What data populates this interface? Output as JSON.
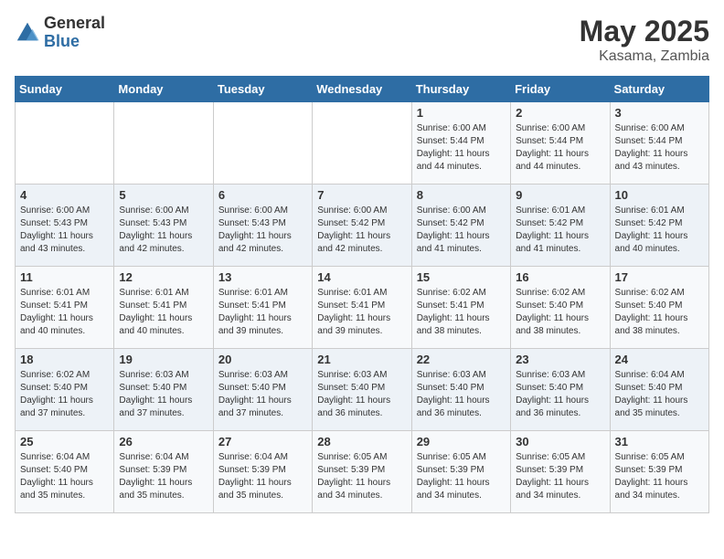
{
  "logo": {
    "text_general": "General",
    "text_blue": "Blue"
  },
  "title": "May 2025",
  "subtitle": "Kasama, Zambia",
  "days_of_week": [
    "Sunday",
    "Monday",
    "Tuesday",
    "Wednesday",
    "Thursday",
    "Friday",
    "Saturday"
  ],
  "weeks": [
    [
      {
        "day": "",
        "info": ""
      },
      {
        "day": "",
        "info": ""
      },
      {
        "day": "",
        "info": ""
      },
      {
        "day": "",
        "info": ""
      },
      {
        "day": "1",
        "info": "Sunrise: 6:00 AM\nSunset: 5:44 PM\nDaylight: 11 hours\nand 44 minutes."
      },
      {
        "day": "2",
        "info": "Sunrise: 6:00 AM\nSunset: 5:44 PM\nDaylight: 11 hours\nand 44 minutes."
      },
      {
        "day": "3",
        "info": "Sunrise: 6:00 AM\nSunset: 5:44 PM\nDaylight: 11 hours\nand 43 minutes."
      }
    ],
    [
      {
        "day": "4",
        "info": "Sunrise: 6:00 AM\nSunset: 5:43 PM\nDaylight: 11 hours\nand 43 minutes."
      },
      {
        "day": "5",
        "info": "Sunrise: 6:00 AM\nSunset: 5:43 PM\nDaylight: 11 hours\nand 42 minutes."
      },
      {
        "day": "6",
        "info": "Sunrise: 6:00 AM\nSunset: 5:43 PM\nDaylight: 11 hours\nand 42 minutes."
      },
      {
        "day": "7",
        "info": "Sunrise: 6:00 AM\nSunset: 5:42 PM\nDaylight: 11 hours\nand 42 minutes."
      },
      {
        "day": "8",
        "info": "Sunrise: 6:00 AM\nSunset: 5:42 PM\nDaylight: 11 hours\nand 41 minutes."
      },
      {
        "day": "9",
        "info": "Sunrise: 6:01 AM\nSunset: 5:42 PM\nDaylight: 11 hours\nand 41 minutes."
      },
      {
        "day": "10",
        "info": "Sunrise: 6:01 AM\nSunset: 5:42 PM\nDaylight: 11 hours\nand 40 minutes."
      }
    ],
    [
      {
        "day": "11",
        "info": "Sunrise: 6:01 AM\nSunset: 5:41 PM\nDaylight: 11 hours\nand 40 minutes."
      },
      {
        "day": "12",
        "info": "Sunrise: 6:01 AM\nSunset: 5:41 PM\nDaylight: 11 hours\nand 40 minutes."
      },
      {
        "day": "13",
        "info": "Sunrise: 6:01 AM\nSunset: 5:41 PM\nDaylight: 11 hours\nand 39 minutes."
      },
      {
        "day": "14",
        "info": "Sunrise: 6:01 AM\nSunset: 5:41 PM\nDaylight: 11 hours\nand 39 minutes."
      },
      {
        "day": "15",
        "info": "Sunrise: 6:02 AM\nSunset: 5:41 PM\nDaylight: 11 hours\nand 38 minutes."
      },
      {
        "day": "16",
        "info": "Sunrise: 6:02 AM\nSunset: 5:40 PM\nDaylight: 11 hours\nand 38 minutes."
      },
      {
        "day": "17",
        "info": "Sunrise: 6:02 AM\nSunset: 5:40 PM\nDaylight: 11 hours\nand 38 minutes."
      }
    ],
    [
      {
        "day": "18",
        "info": "Sunrise: 6:02 AM\nSunset: 5:40 PM\nDaylight: 11 hours\nand 37 minutes."
      },
      {
        "day": "19",
        "info": "Sunrise: 6:03 AM\nSunset: 5:40 PM\nDaylight: 11 hours\nand 37 minutes."
      },
      {
        "day": "20",
        "info": "Sunrise: 6:03 AM\nSunset: 5:40 PM\nDaylight: 11 hours\nand 37 minutes."
      },
      {
        "day": "21",
        "info": "Sunrise: 6:03 AM\nSunset: 5:40 PM\nDaylight: 11 hours\nand 36 minutes."
      },
      {
        "day": "22",
        "info": "Sunrise: 6:03 AM\nSunset: 5:40 PM\nDaylight: 11 hours\nand 36 minutes."
      },
      {
        "day": "23",
        "info": "Sunrise: 6:03 AM\nSunset: 5:40 PM\nDaylight: 11 hours\nand 36 minutes."
      },
      {
        "day": "24",
        "info": "Sunrise: 6:04 AM\nSunset: 5:40 PM\nDaylight: 11 hours\nand 35 minutes."
      }
    ],
    [
      {
        "day": "25",
        "info": "Sunrise: 6:04 AM\nSunset: 5:40 PM\nDaylight: 11 hours\nand 35 minutes."
      },
      {
        "day": "26",
        "info": "Sunrise: 6:04 AM\nSunset: 5:39 PM\nDaylight: 11 hours\nand 35 minutes."
      },
      {
        "day": "27",
        "info": "Sunrise: 6:04 AM\nSunset: 5:39 PM\nDaylight: 11 hours\nand 35 minutes."
      },
      {
        "day": "28",
        "info": "Sunrise: 6:05 AM\nSunset: 5:39 PM\nDaylight: 11 hours\nand 34 minutes."
      },
      {
        "day": "29",
        "info": "Sunrise: 6:05 AM\nSunset: 5:39 PM\nDaylight: 11 hours\nand 34 minutes."
      },
      {
        "day": "30",
        "info": "Sunrise: 6:05 AM\nSunset: 5:39 PM\nDaylight: 11 hours\nand 34 minutes."
      },
      {
        "day": "31",
        "info": "Sunrise: 6:05 AM\nSunset: 5:39 PM\nDaylight: 11 hours\nand 34 minutes."
      }
    ]
  ]
}
